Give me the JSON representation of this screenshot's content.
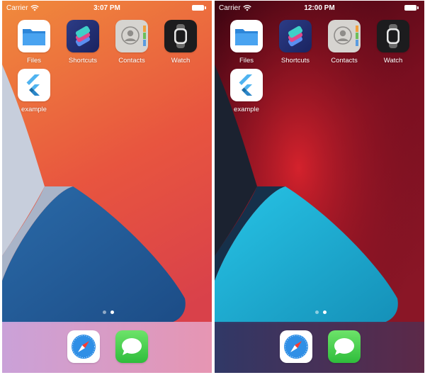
{
  "screens": [
    {
      "theme": "light",
      "status": {
        "carrier": "Carrier",
        "time": "3:07 PM"
      },
      "apps": [
        {
          "label": "Files",
          "icon": "files-icon"
        },
        {
          "label": "Shortcuts",
          "icon": "shortcuts-icon"
        },
        {
          "label": "Contacts",
          "icon": "contacts-icon"
        },
        {
          "label": "Watch",
          "icon": "watch-icon"
        },
        {
          "label": "example",
          "icon": "flutter-icon"
        }
      ],
      "page_indicator": {
        "pages": 2,
        "current": 2
      },
      "dock": [
        {
          "icon": "safari-icon"
        },
        {
          "icon": "messages-icon"
        }
      ]
    },
    {
      "theme": "dark",
      "status": {
        "carrier": "Carrier",
        "time": "12:00 PM"
      },
      "apps": [
        {
          "label": "Files",
          "icon": "files-icon"
        },
        {
          "label": "Shortcuts",
          "icon": "shortcuts-icon"
        },
        {
          "label": "Contacts",
          "icon": "contacts-icon"
        },
        {
          "label": "Watch",
          "icon": "watch-icon"
        },
        {
          "label": "example",
          "icon": "flutter-icon"
        }
      ],
      "page_indicator": {
        "pages": 2,
        "current": 2
      },
      "dock": [
        {
          "icon": "safari-icon"
        },
        {
          "icon": "messages-icon"
        }
      ]
    }
  ]
}
